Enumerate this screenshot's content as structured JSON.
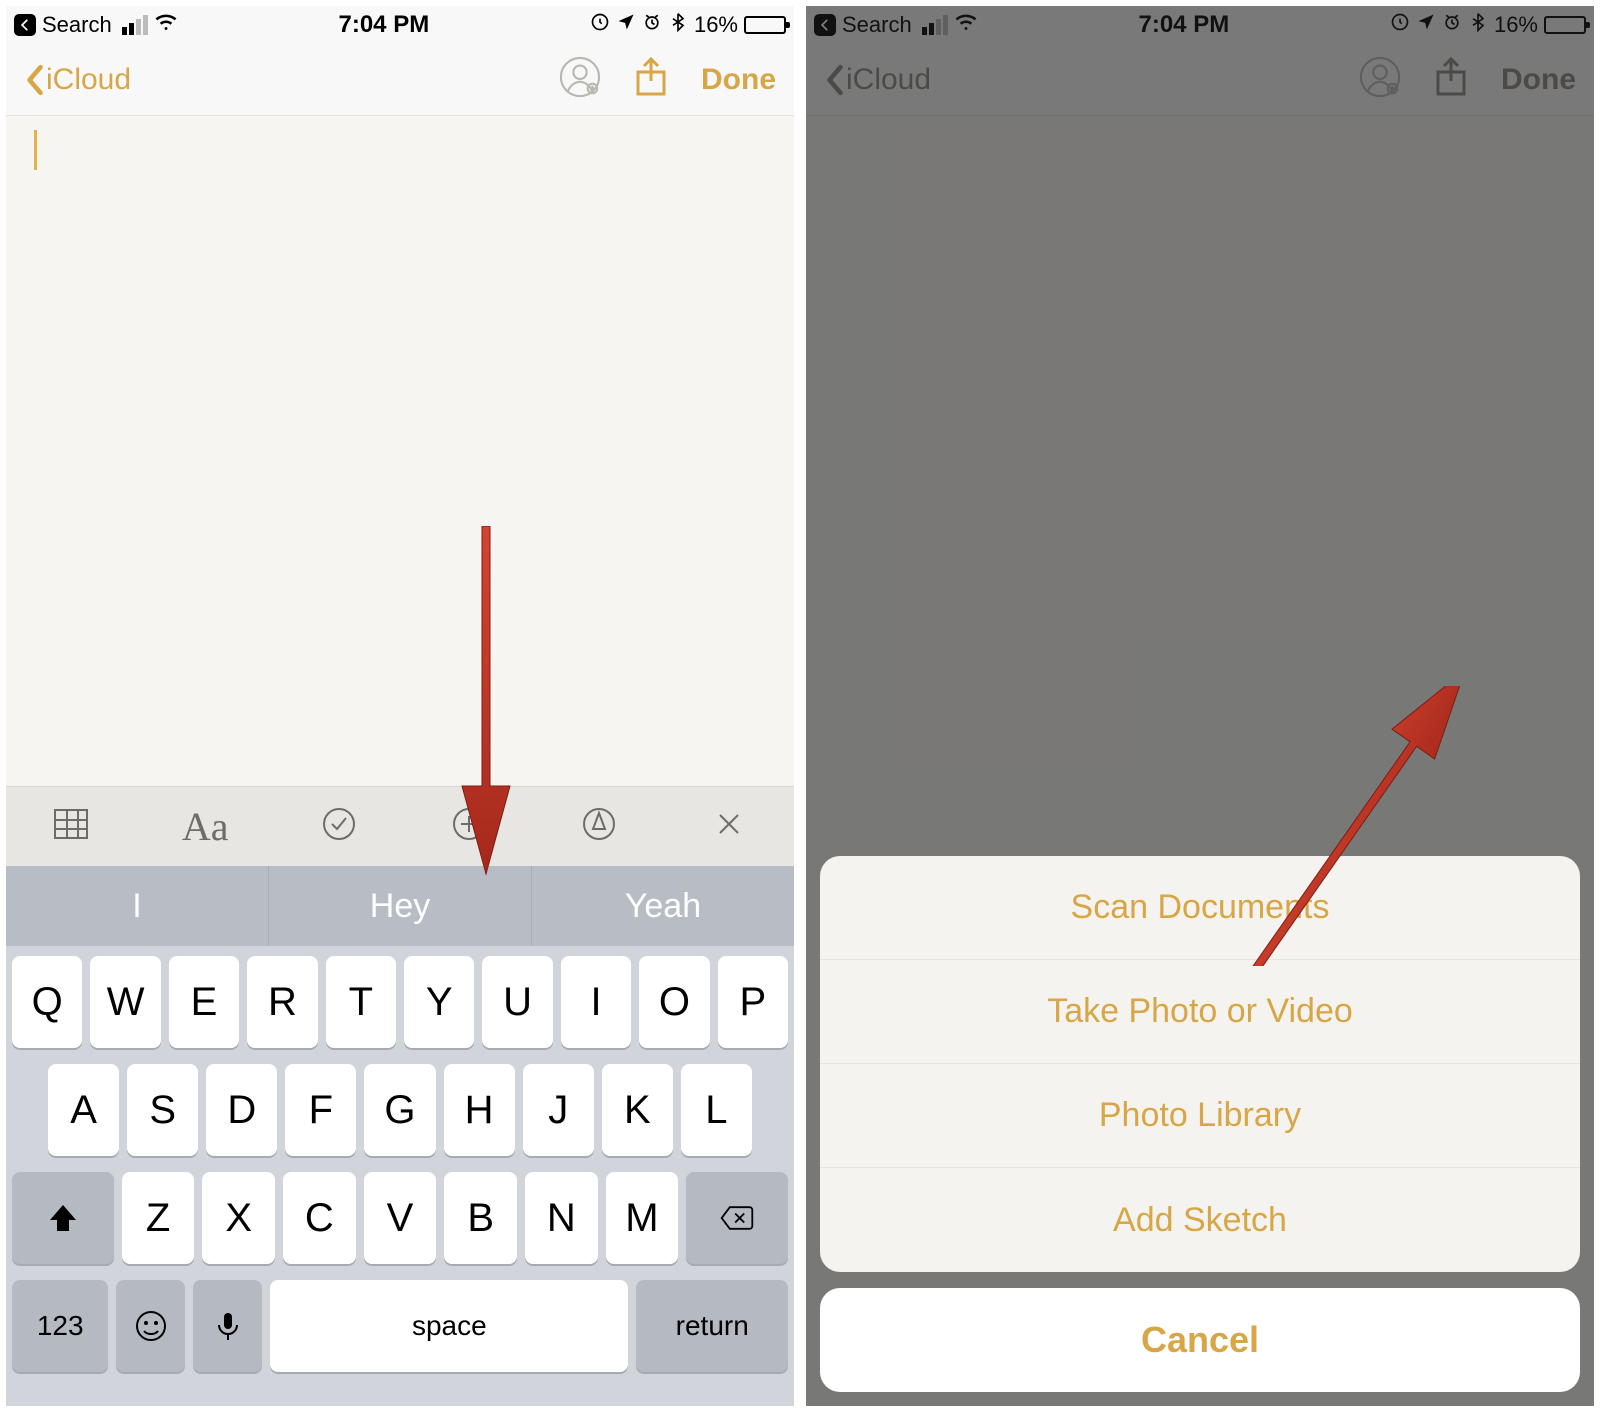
{
  "status": {
    "search_label": "Search",
    "time": "7:04 PM",
    "battery_pct": "16%"
  },
  "nav": {
    "back_label": "iCloud",
    "done_label": "Done"
  },
  "format_bar": {
    "text_style_label": "Aa"
  },
  "suggestions": [
    "I",
    "Hey",
    "Yeah"
  ],
  "keyboard": {
    "row1": [
      "Q",
      "W",
      "E",
      "R",
      "T",
      "Y",
      "U",
      "I",
      "O",
      "P"
    ],
    "row2": [
      "A",
      "S",
      "D",
      "F",
      "G",
      "H",
      "J",
      "K",
      "L"
    ],
    "row3": [
      "Z",
      "X",
      "C",
      "V",
      "B",
      "N",
      "M"
    ],
    "num_label": "123",
    "space_label": "space",
    "return_label": "return"
  },
  "action_sheet": {
    "items": [
      "Scan Documents",
      "Take Photo or Video",
      "Photo Library",
      "Add Sketch"
    ],
    "cancel_label": "Cancel"
  }
}
